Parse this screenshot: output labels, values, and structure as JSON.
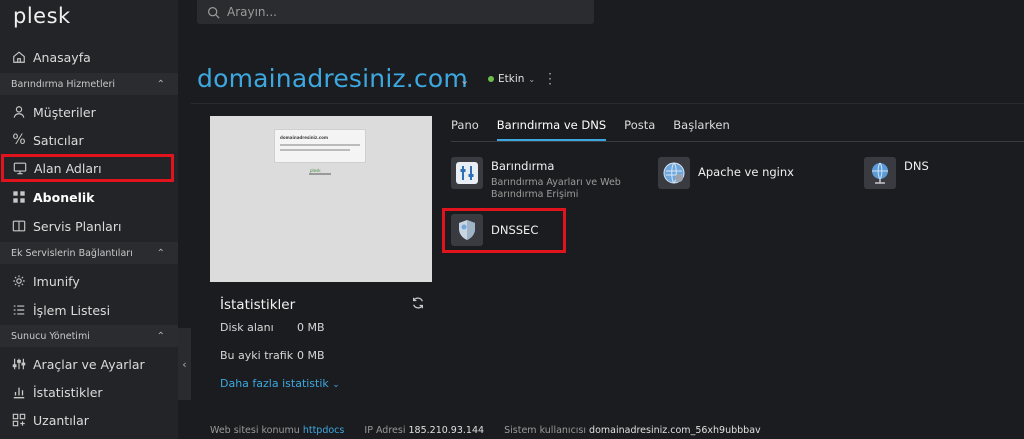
{
  "app": {
    "logo": "plesk"
  },
  "search": {
    "placeholder": "Arayın..."
  },
  "sidebar": {
    "home": "Anasayfa",
    "sections": {
      "hosting": "Barındırma Hizmetleri",
      "extensions": "Ek Servislerin Bağlantıları",
      "server": "Sunucu Yönetimi"
    },
    "items": {
      "customers": "Müşteriler",
      "resellers": "Satıcılar",
      "domains": "Alan Adları",
      "subscriptions": "Abonelik",
      "service_plans": "Servis Planları",
      "imunify": "Imunify",
      "task_list": "İşlem Listesi",
      "tools": "Araçlar ve Ayarlar",
      "statistics": "İstatistikler",
      "extensions": "Uzantılar"
    }
  },
  "domain": {
    "name": "domainadresiniz.com",
    "status": "Etkin",
    "status_color": "#6cc04a"
  },
  "preview": {
    "site_title": "domainadresiniz.com",
    "footer_text": "plesk"
  },
  "stats": {
    "title": "İstatistikler",
    "disk_label": "Disk alanı",
    "disk_value": "0 MB",
    "traffic_label": "Bu ayki trafik",
    "traffic_value": "0 MB",
    "more_link": "Daha fazla istatistik"
  },
  "tabs": [
    "Pano",
    "Barındırma ve DNS",
    "Posta",
    "Başlarken"
  ],
  "active_tab": "Barındırma ve DNS",
  "tiles": {
    "hosting": {
      "title": "Barındırma",
      "desc": "Barındırma Ayarları ve Web Barındırma Erişimi"
    },
    "apache": {
      "title": "Apache ve nginx"
    },
    "dns": {
      "title": "DNS"
    },
    "dnssec": {
      "title": "DNSSEC"
    }
  },
  "footer": {
    "location_label": "Web sitesi konumu",
    "location_value": "httpdocs",
    "ip_label": "IP Adresi",
    "ip_value": "185.210.93.144",
    "user_label": "Sistem kullanıcısı",
    "user_value": "domainadresiniz.com_56xh9ubbbav"
  },
  "colors": {
    "accent": "#3da8e0",
    "highlight": "#e1141e",
    "sidebar_bg": "#232427",
    "main_bg": "#1b1c1f"
  }
}
